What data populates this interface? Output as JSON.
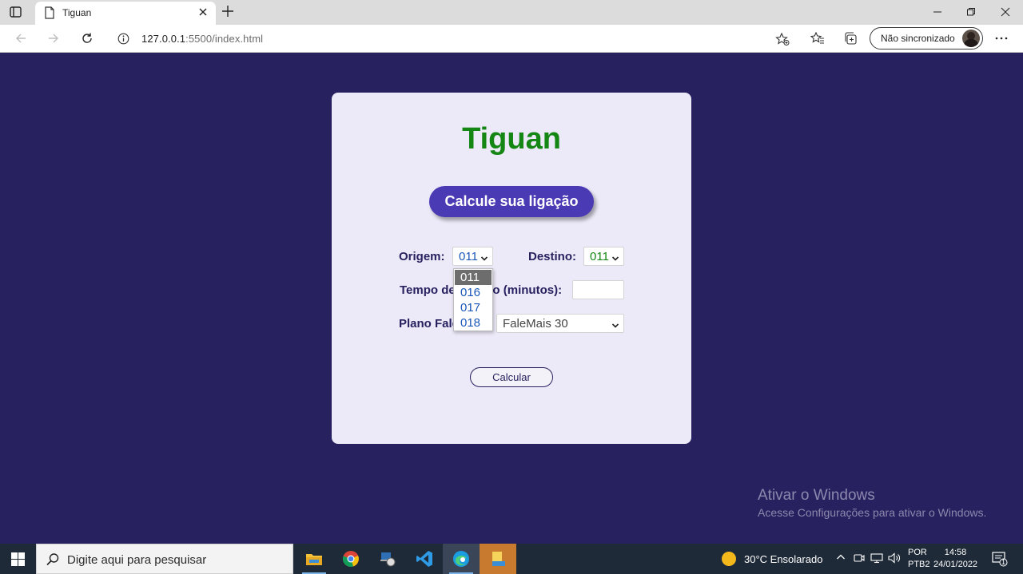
{
  "browser": {
    "tab_title": "Tiguan",
    "url_host": "127.0.0.1",
    "url_path": ":5500/index.html",
    "sync_label": "Não sincronizado"
  },
  "page": {
    "title": "Tiguan",
    "cta_label": "Calcule sua ligação",
    "origin_label": "Origem:",
    "origin_value": "011",
    "destination_label": "Destino:",
    "destination_value": "011",
    "time_label": "Tempo de ligação (minutos):",
    "time_value": "",
    "plan_label": "Plano FaleMais:",
    "plan_value": "FaleMais 30",
    "calc_label": "Calcular",
    "origin_options": [
      "011",
      "016",
      "017",
      "018"
    ]
  },
  "watermark": {
    "title": "Ativar o Windows",
    "subtitle": "Acesse Configurações para ativar o Windows."
  },
  "taskbar": {
    "search_placeholder": "Digite aqui para pesquisar",
    "weather": "30°C  Ensolarado",
    "lang_line1": "POR",
    "lang_line2": "PTB2",
    "time": "14:58",
    "date": "24/01/2022",
    "notif_count": "1"
  },
  "colors": {
    "background": "#27215f",
    "card": "#ece9f8",
    "title": "#138613",
    "accent": "#4a3ab4"
  }
}
